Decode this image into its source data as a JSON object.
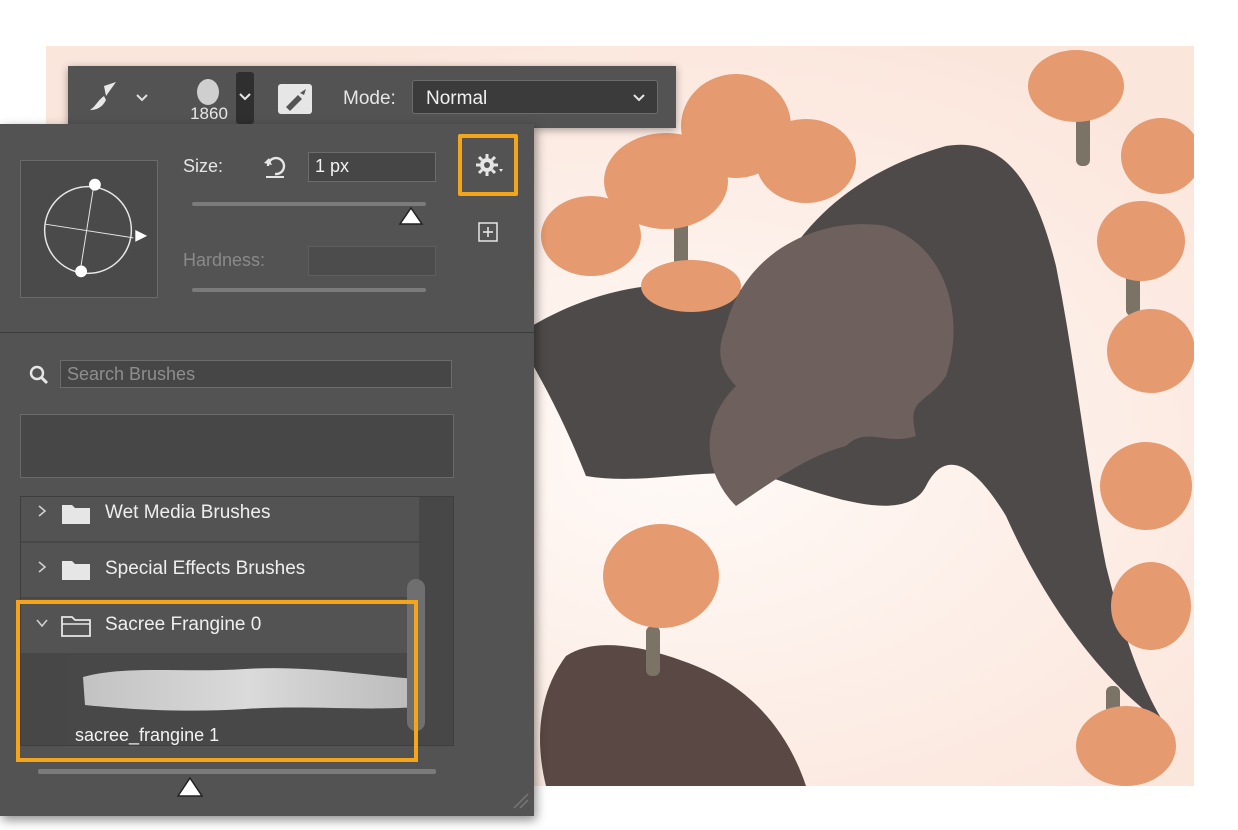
{
  "options_bar": {
    "brush_preset_size": "1860",
    "mode_label": "Mode:",
    "mode_value": "Normal"
  },
  "brush_panel": {
    "size_label": "Size:",
    "size_value": "1 px",
    "hardness_label": "Hardness:",
    "search_placeholder": "Search Brushes",
    "groups": [
      {
        "label": "Wet Media Brushes",
        "expanded": false
      },
      {
        "label": "Special Effects Brushes",
        "expanded": false
      },
      {
        "label": "Sacree Frangine 0",
        "expanded": true
      }
    ],
    "brushes": [
      {
        "label": "sacree_frangine 1"
      }
    ]
  },
  "colors": {
    "panel_bg": "#535353",
    "highlight": "#f5a519",
    "canvas_bg": "#fbe9e2",
    "flower": "#e59a70",
    "figure_dark": "#4f4a4a",
    "figure_face": "#6e605d",
    "hand": "#5a4844",
    "stem": "#7b7466"
  }
}
